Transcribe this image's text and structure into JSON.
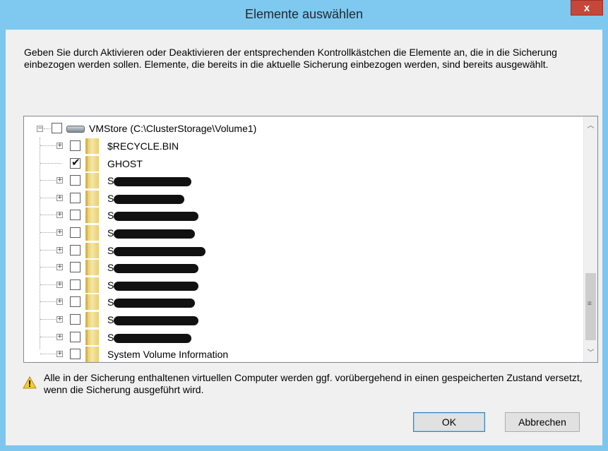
{
  "window": {
    "title": "Elemente auswählen",
    "close_glyph": "x"
  },
  "description": "Geben Sie durch Aktivieren oder Deaktivieren der entsprechenden Kontrollkästchen die Elemente an, die in die Sicherung einbezogen werden sollen. Elemente, die bereits in die aktuelle Sicherung einbezogen werden, sind bereits ausgewählt.",
  "tree": {
    "root": {
      "label": "VMStore (C:\\ClusterStorage\\Volume1)",
      "checked": false,
      "expander": "−",
      "icon": "drive-icon"
    },
    "items": [
      {
        "label": "$RECYCLE.BIN",
        "checked": false,
        "expandable": true,
        "redacted": false
      },
      {
        "label": "GHOST",
        "checked": true,
        "expandable": false,
        "redacted": false
      },
      {
        "label": "S",
        "checked": false,
        "expandable": true,
        "redacted": true
      },
      {
        "label": "S",
        "checked": false,
        "expandable": true,
        "redacted": true
      },
      {
        "label": "S",
        "checked": false,
        "expandable": true,
        "redacted": true
      },
      {
        "label": "S",
        "checked": false,
        "expandable": true,
        "redacted": true
      },
      {
        "label": "S",
        "checked": false,
        "expandable": true,
        "redacted": true
      },
      {
        "label": "S",
        "checked": false,
        "expandable": true,
        "redacted": true
      },
      {
        "label": "S",
        "checked": false,
        "expandable": true,
        "redacted": true
      },
      {
        "label": "S",
        "checked": false,
        "expandable": true,
        "redacted": true
      },
      {
        "label": "S",
        "checked": false,
        "expandable": true,
        "redacted": true
      },
      {
        "label": "S",
        "checked": false,
        "expandable": true,
        "redacted": true
      },
      {
        "label": "System Volume Information",
        "checked": false,
        "expandable": true,
        "redacted": false
      }
    ]
  },
  "warning": {
    "icon": "warning-icon",
    "text": "Alle in der Sicherung enthaltenen virtuellen Computer werden ggf. vorübergehend in einen gespeicherten Zustand versetzt, wenn die Sicherung ausgeführt wird."
  },
  "buttons": {
    "ok": "OK",
    "cancel": "Abbrechen"
  },
  "colors": {
    "titlebar": "#7fc8ef",
    "close": "#c7463a",
    "client": "#f0f0f0"
  }
}
